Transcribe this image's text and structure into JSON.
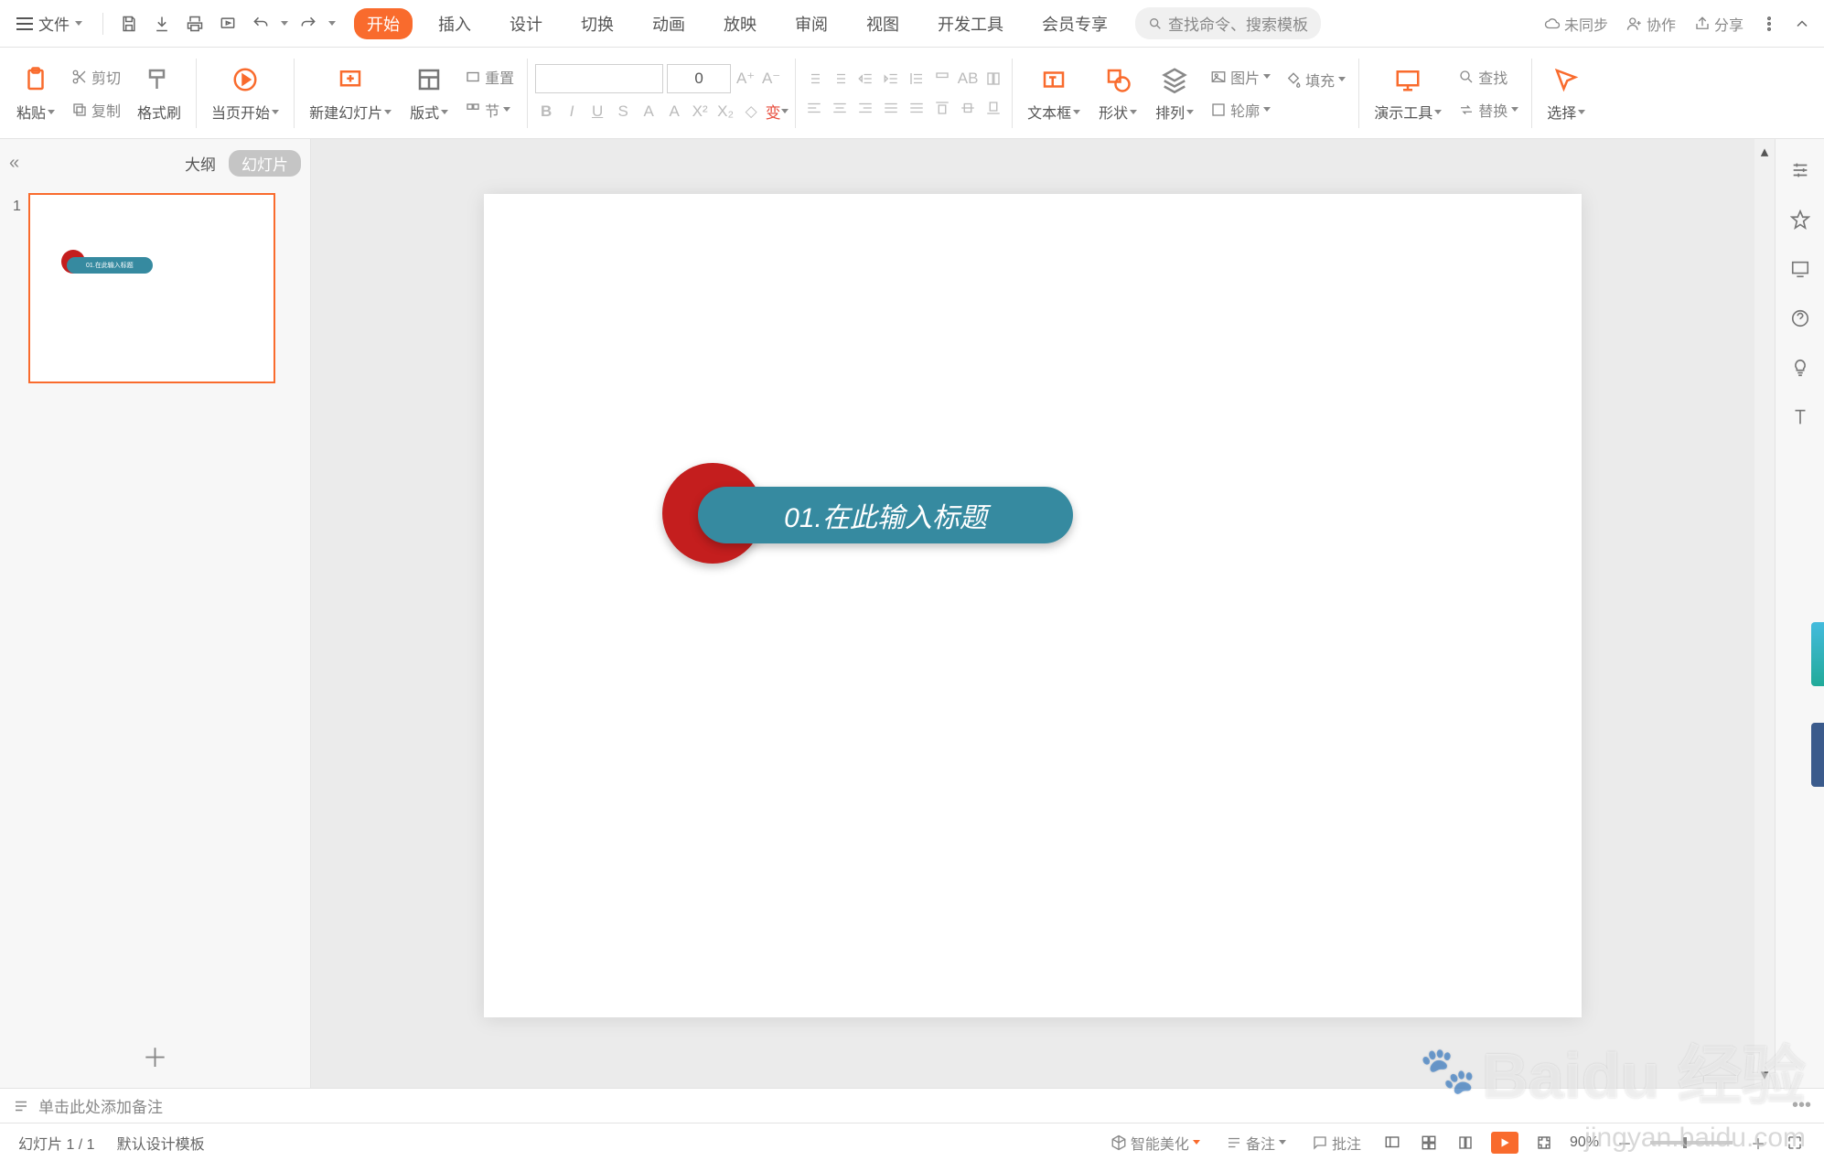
{
  "titlebar": {
    "file_label": "文件",
    "sync_label": "未同步",
    "collab_label": "协作",
    "share_label": "分享"
  },
  "menu": {
    "tabs": [
      "开始",
      "插入",
      "设计",
      "切换",
      "动画",
      "放映",
      "审阅",
      "视图",
      "开发工具",
      "会员专享"
    ],
    "active_index": 0,
    "search_placeholder": "查找命令、搜索模板"
  },
  "ribbon": {
    "paste": "粘贴",
    "cut": "剪切",
    "copy": "复制",
    "format_painter": "格式刷",
    "from_current": "当页开始",
    "new_slide": "新建幻灯片",
    "layout": "版式",
    "section": "节",
    "reset": "重置",
    "font_size": "0",
    "textbox": "文本框",
    "shape": "形状",
    "arrange": "排列",
    "picture": "图片",
    "fill": "填充",
    "outline": "轮廓",
    "tools": "演示工具",
    "find": "查找",
    "replace": "替换",
    "select": "选择"
  },
  "panel": {
    "outline_tab": "大纲",
    "slides_tab": "幻灯片",
    "slide_number": "1",
    "thumb_text": "01.在此输入标题"
  },
  "slide": {
    "title_text": "01.在此输入标题"
  },
  "notes": {
    "placeholder": "单击此处添加备注"
  },
  "status": {
    "slide_counter": "幻灯片 1 / 1",
    "template": "默认设计模板",
    "smart_beautify": "智能美化",
    "notes_btn": "备注",
    "comments_btn": "批注",
    "zoom": "90%"
  },
  "watermark": {
    "main": "Baidu 经验",
    "sub": "jingyan.baidu.com"
  }
}
